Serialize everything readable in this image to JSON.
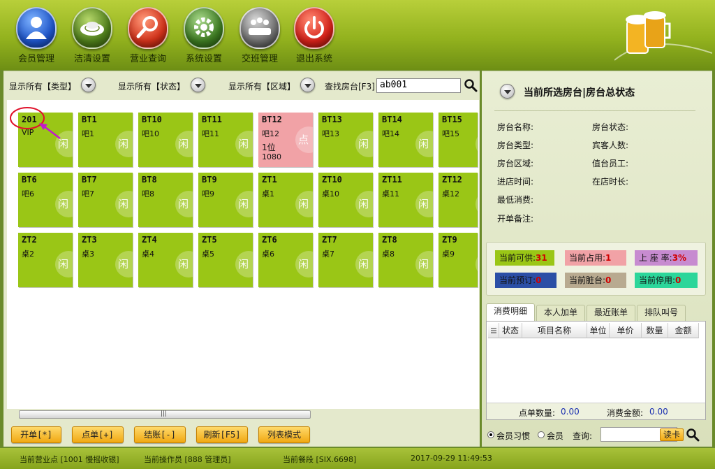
{
  "toolbar": {
    "member": "会员管理",
    "clean": "洁清设置",
    "query": "营业查询",
    "settings": "系统设置",
    "shift": "交班管理",
    "exit": "退出系统"
  },
  "filters": {
    "type": "显示所有【类型】",
    "status": "显示所有【状态】",
    "area": "显示所有【区域】",
    "find_label": "查找房台[F3]",
    "find_value": "ab001"
  },
  "rooms": [
    {
      "code": "201",
      "name": "VIP",
      "badge": "闲"
    },
    {
      "code": "BT1",
      "name": "吧1",
      "badge": "闲"
    },
    {
      "code": "BT10",
      "name": "吧10",
      "badge": "闲"
    },
    {
      "code": "BT11",
      "name": "吧11",
      "badge": "闲"
    },
    {
      "code": "BT12",
      "name": "吧12",
      "badge": "点",
      "guests": "1位",
      "amount": "1080"
    },
    {
      "code": "BT13",
      "name": "吧13",
      "badge": "闲"
    },
    {
      "code": "BT14",
      "name": "吧14",
      "badge": "闲"
    },
    {
      "code": "BT15",
      "name": "吧15",
      "badge": "闲"
    },
    {
      "code": "BT6",
      "name": "吧6",
      "badge": "闲"
    },
    {
      "code": "BT7",
      "name": "吧7",
      "badge": "闲"
    },
    {
      "code": "BT8",
      "name": "吧8",
      "badge": "闲"
    },
    {
      "code": "BT9",
      "name": "吧9",
      "badge": "闲"
    },
    {
      "code": "ZT1",
      "name": "桌1",
      "badge": "闲"
    },
    {
      "code": "ZT10",
      "name": "桌10",
      "badge": "闲"
    },
    {
      "code": "ZT11",
      "name": "桌11",
      "badge": "闲"
    },
    {
      "code": "ZT12",
      "name": "桌12",
      "badge": "闲"
    },
    {
      "code": "ZT2",
      "name": "桌2",
      "badge": "闲"
    },
    {
      "code": "ZT3",
      "name": "桌3",
      "badge": "闲"
    },
    {
      "code": "ZT4",
      "name": "桌4",
      "badge": "闲"
    },
    {
      "code": "ZT5",
      "name": "桌5",
      "badge": "闲"
    },
    {
      "code": "ZT6",
      "name": "桌6",
      "badge": "闲"
    },
    {
      "code": "ZT7",
      "name": "桌7",
      "badge": "闲"
    },
    {
      "code": "ZT8",
      "name": "桌8",
      "badge": "闲"
    },
    {
      "code": "ZT9",
      "name": "桌9",
      "badge": "闲"
    }
  ],
  "scrollbar": {
    "grip": "|||"
  },
  "actions": {
    "open": "开单[*]",
    "order": "点单[+]",
    "checkout": "结账[-]",
    "refresh": "刷新[F5]",
    "list_mode": "列表模式"
  },
  "info": {
    "title": "当前所选房台|房台总状态",
    "room_name": "房台名称:",
    "room_status": "房台状态:",
    "room_type": "房台类型:",
    "guest_count": "宾客人数:",
    "room_area": "房台区域:",
    "staff": "值台员工:",
    "enter_time": "进店时间:",
    "duration": "在店时长:",
    "min_spend": "最低消费:",
    "note": "开单备注:"
  },
  "stats": {
    "available_label": "当前可供:",
    "available": "31",
    "occupied_label": "当前占用:",
    "occupied": "1",
    "rate_label": "上 座 率:",
    "rate": "3%",
    "reserved_label": "当前预订:",
    "reserved": "0",
    "dirty_label": "当前脏台:",
    "dirty": "0",
    "stopped_label": "当前停用:",
    "stopped": "0",
    "colors": {
      "available": "#9ac616",
      "occupied": "#f1a2a6",
      "rate": "#c78bd0",
      "reserved": "#2b4fa6",
      "dirty": "#b8aa90",
      "stopped": "#2cd69a"
    }
  },
  "tabs": [
    "消费明细",
    "本人加单",
    "最近账单",
    "排队叫号"
  ],
  "columns": [
    "状态",
    "项目名称",
    "单位",
    "单价",
    "数量",
    "金额"
  ],
  "detail_footer": {
    "count_label": "点单数量:",
    "count": "0.00",
    "amount_label": "消费金额:",
    "amount": "0.00"
  },
  "member": {
    "habit": "会员习惯",
    "member": "会员",
    "query_label": "查询:",
    "read_card": "读卡"
  },
  "statusbar": {
    "outlet": "当前营业点 [1001 慢摇收银]",
    "operator": "当前操作员 [888 管理员]",
    "meal": "当前餐段 [SIX.6698]",
    "datetime": "2017-09-29 11:49:53"
  }
}
